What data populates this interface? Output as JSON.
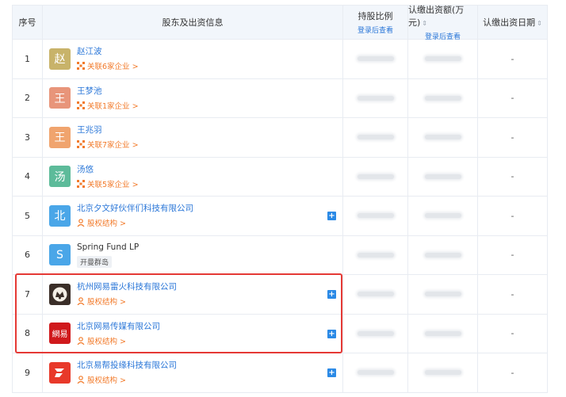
{
  "header": {
    "index": "序号",
    "shareholder": "股东及出资信息",
    "ratio": "持股比例",
    "ratio_sub": "登录后查看",
    "amount": "认缴出资额(万元)",
    "amount_sub": "登录后查看",
    "date": "认缴出资日期"
  },
  "rows": [
    {
      "index": "1",
      "avatar_char": "赵",
      "avatar_color": "#c8b36a",
      "name": "赵江波",
      "relation": "关联6家企业 >",
      "date": "-"
    },
    {
      "index": "2",
      "avatar_char": "王",
      "avatar_color": "#e8957a",
      "name": "王梦池",
      "relation": "关联1家企业 >",
      "date": "-"
    },
    {
      "index": "3",
      "avatar_char": "王",
      "avatar_color": "#f0a46e",
      "name": "王兆羽",
      "relation": "关联7家企业 >",
      "date": "-"
    },
    {
      "index": "4",
      "avatar_char": "汤",
      "avatar_color": "#5dbb9a",
      "name": "汤悠",
      "relation": "关联5家企业 >",
      "date": "-"
    },
    {
      "index": "5",
      "avatar_char": "北",
      "avatar_color": "#4aa6e8",
      "name": "北京夕文好伙伴们科技有限公司",
      "relation": "股权结构 >",
      "date": "-"
    },
    {
      "index": "6",
      "avatar_char": "S",
      "avatar_color": "#4aa6e8",
      "name": "Spring Fund LP",
      "tag": "开曼群岛",
      "date": "-"
    },
    {
      "index": "7",
      "name": "杭州网易雷火科技有限公司",
      "relation": "股权结构 >",
      "date": "-"
    },
    {
      "index": "8",
      "logo_text": "網易",
      "name": "北京网易传媒有限公司",
      "relation": "股权结构 >",
      "date": "-"
    },
    {
      "index": "9",
      "name": "北京易帮投缘科技有限公司",
      "relation": "股权结构 >",
      "date": "-"
    }
  ],
  "colors": {
    "link": "#2b77d8",
    "relation": "#f27a2a",
    "highlight": "#e53935",
    "plus": "#2b8ae6"
  }
}
